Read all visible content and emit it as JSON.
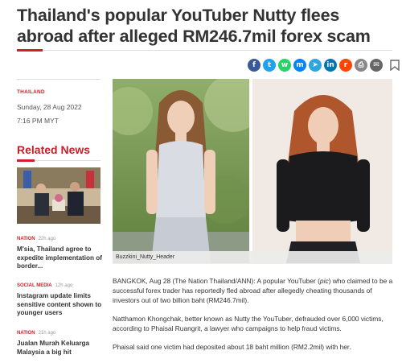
{
  "article": {
    "headline": "Thailand's popular YouTuber Nutty flees abroad after alleged RM246.7mil forex scam",
    "section": "THAILAND",
    "date": "Sunday, 28 Aug 2022",
    "time": "7:16 PM MYT",
    "image_caption": "Buzzkini_Nutty_Header",
    "paragraphs": [
      {
        "before": "BANGKOK, Aug 28 (The Nation Thailand/ANN): A popular YouTuber (",
        "italic": "pic",
        "after": ") who claimed to be a successful forex trader has reportedly fled abroad after allegedly cheating thousands of investors out of two billion baht (RM246.7mil)."
      },
      {
        "before": "Natthamon Khongchak, better known as Nutty the YouTuber, defrauded over 6,000 victims, according to Phaisal Ruangrit, a lawyer who campaigns to help fraud victims.",
        "italic": "",
        "after": ""
      },
      {
        "before": "Phaisal said one victim had deposited about 18 baht million (RM2.2mil) with her.",
        "italic": "",
        "after": ""
      }
    ]
  },
  "share": {
    "buttons": [
      {
        "icon": "facebook-icon",
        "glyph": "f",
        "color": "#3b5998"
      },
      {
        "icon": "twitter-icon",
        "glyph": "t",
        "color": "#1da1f2"
      },
      {
        "icon": "whatsapp-icon",
        "glyph": "w",
        "color": "#25d366"
      },
      {
        "icon": "messenger-icon",
        "glyph": "m",
        "color": "#0084ff"
      },
      {
        "icon": "telegram-icon",
        "glyph": "➤",
        "color": "#2ca5e0"
      },
      {
        "icon": "linkedin-icon",
        "glyph": "in",
        "color": "#0077b5"
      },
      {
        "icon": "reddit-icon",
        "glyph": "r",
        "color": "#ff4500"
      },
      {
        "icon": "print-icon",
        "glyph": "⎙",
        "color": "#888888"
      },
      {
        "icon": "email-icon",
        "glyph": "✉",
        "color": "#666666"
      }
    ]
  },
  "related": {
    "title": "Related News",
    "items": [
      {
        "category": "NATION",
        "time": "22h ago",
        "headline": "M'sia, Thailand agree to expedite implementation of border..."
      },
      {
        "category": "SOCIAL MEDIA",
        "time": "12h ago",
        "headline": "Instagram update limits sensitive content shown to younger users"
      },
      {
        "category": "NATION",
        "time": "21h ago",
        "headline": "Jualan Murah Keluarga Malaysia a big hit"
      }
    ]
  },
  "colors": {
    "accent": "#d0202a",
    "text": "#333333"
  }
}
